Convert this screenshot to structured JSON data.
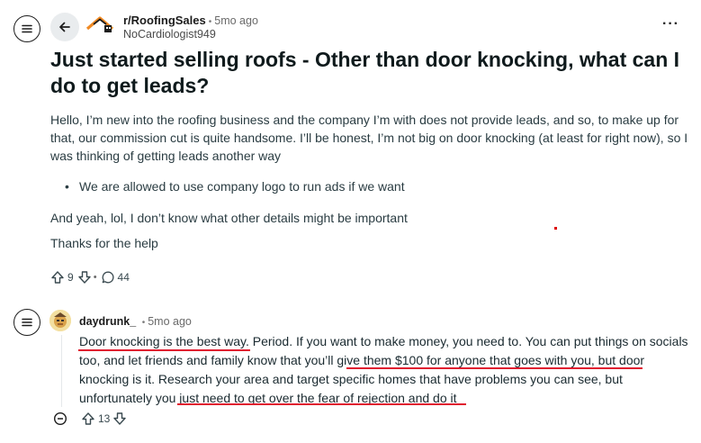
{
  "post": {
    "subreddit": "r/RoofingSales",
    "dot": "•",
    "age": "5mo ago",
    "author": "NoCardiologist949",
    "more": "···",
    "title": "Just started selling roofs - Other than door knocking, what can I do to get leads?",
    "paragraph1": "Hello, I’m new into the roofing business and the company I’m with does not provide leads, and so, to make up for that, our commission cut is quite handsome. I’ll be honest, I’m not big on door knocking (at least for right now), so I was thinking of getting leads another way",
    "bullet1": "We are allowed to use company logo to run ads if we want",
    "paragraph2": "And yeah, lol, I don’t know what other details might be important",
    "paragraph3": "Thanks for the help",
    "upvotes": "9",
    "comments": "44"
  },
  "comment": {
    "username": "daydrunk_",
    "dot": "•",
    "age": "5mo ago",
    "text_part1": "Door knocking is the best way.",
    "text_part2": " Period. If you want to make money, you need to. You can put things on socials too, and let friends and family know that ",
    "text_part3": "you’ll give them $100 for anyone that goes with you,",
    "text_part4": " but door knocking is it. Research your area and target specific homes that have problems you can see, but unfortunately you ",
    "text_part5": "just need to get over the fear of rejection and do it",
    "upvotes": "13"
  },
  "icons": {
    "menu": "hamburger-icon",
    "back": "arrow-left-icon",
    "logo": "roof-house-logo",
    "upvote": "arrow-up-icon",
    "downvote": "arrow-down-icon",
    "comments": "speech-bubble-icon",
    "collapse": "minus-circle-icon"
  },
  "colors": {
    "underline": "#e0192f",
    "logo_orange": "#f08a24",
    "text": "#1a1a1b"
  }
}
